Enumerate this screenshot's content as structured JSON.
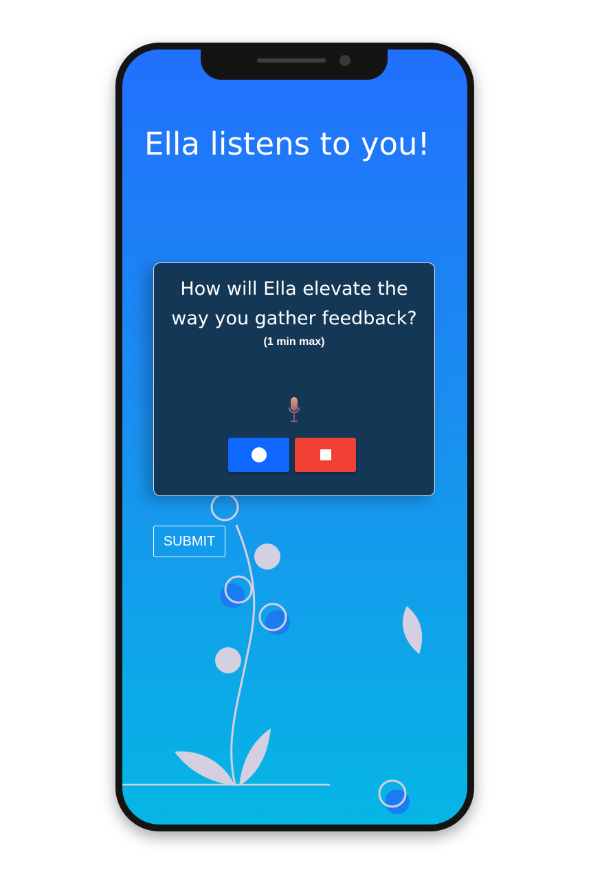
{
  "header": {
    "title": "Ella listens to you!"
  },
  "card": {
    "question": "How will Ella elevate the way you gather feedback?",
    "hint": "(1 min max)",
    "mic_icon": "microphone-icon",
    "record_icon": "record-circle-icon",
    "stop_icon": "stop-square-icon"
  },
  "form": {
    "submit_label": "SUBMIT"
  },
  "colors": {
    "gradient_top": "#2170fd",
    "gradient_bottom": "#06b6e4",
    "card_background": "#153756",
    "record_button": "#0f67fd",
    "stop_button": "#f14135",
    "decoration": "#d4d0e2"
  }
}
